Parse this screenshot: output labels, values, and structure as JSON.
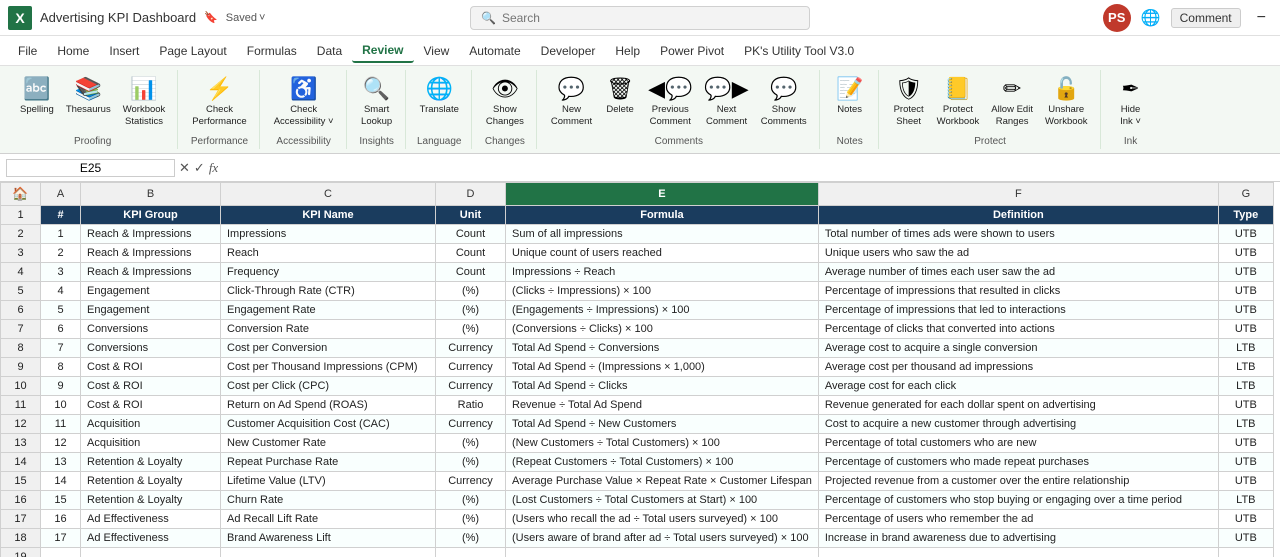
{
  "titleBar": {
    "logo": "X",
    "title": "Advertising KPI Dashboard",
    "saved": "Saved",
    "searchPlaceholder": "Search",
    "commentBtn": "Comment",
    "minimizeBtn": "−",
    "userInitials": "PS"
  },
  "menuBar": {
    "items": [
      "File",
      "Home",
      "Insert",
      "Page Layout",
      "Formulas",
      "Data",
      "Review",
      "View",
      "Automate",
      "Developer",
      "Help",
      "Power Pivot",
      "PK's Utility Tool V3.0"
    ],
    "activeIndex": 6
  },
  "ribbon": {
    "groups": [
      {
        "label": "Proofing",
        "items": [
          {
            "icon": "🔤",
            "label": "Spelling"
          },
          {
            "icon": "📚",
            "label": "Thesaurus"
          },
          {
            "icon": "📊",
            "label": "Workbook\nStatistics"
          }
        ]
      },
      {
        "label": "Performance",
        "items": [
          {
            "icon": "⚡",
            "label": "Check\nPerformance"
          }
        ]
      },
      {
        "label": "Accessibility",
        "items": [
          {
            "icon": "♿",
            "label": "Check\nAccessibility ˅"
          }
        ]
      },
      {
        "label": "Insights",
        "items": [
          {
            "icon": "🔍",
            "label": "Smart\nLookup"
          }
        ]
      },
      {
        "label": "Language",
        "items": [
          {
            "icon": "🌐",
            "label": "Translate"
          }
        ]
      },
      {
        "label": "Changes",
        "items": [
          {
            "icon": "👁",
            "label": "Show\nChanges"
          }
        ]
      },
      {
        "label": "Comments",
        "items": [
          {
            "icon": "💬",
            "label": "New\nComment"
          },
          {
            "icon": "🗑",
            "label": "Delete"
          },
          {
            "icon": "◀💬",
            "label": "Previous\nComment"
          },
          {
            "icon": "💬▶",
            "label": "Next\nComment"
          },
          {
            "icon": "💬",
            "label": "Show\nComments"
          }
        ]
      },
      {
        "label": "Notes",
        "items": [
          {
            "icon": "📝",
            "label": "Notes"
          }
        ]
      },
      {
        "label": "Protect",
        "items": [
          {
            "icon": "🛡",
            "label": "Protect\nSheet"
          },
          {
            "icon": "📒",
            "label": "Protect\nWorkbook"
          },
          {
            "icon": "✏",
            "label": "Allow Edit\nRanges"
          },
          {
            "icon": "🔓",
            "label": "Unshare\nWorkbook"
          }
        ]
      },
      {
        "label": "Ink",
        "items": [
          {
            "icon": "✒",
            "label": "Hide\nInk ˅"
          }
        ]
      }
    ]
  },
  "formulaBar": {
    "cellRef": "E25",
    "formula": ""
  },
  "columns": {
    "headers": [
      "A",
      "B",
      "C",
      "D",
      "E",
      "F",
      "G"
    ],
    "labels": [
      "#",
      "KPI Group",
      "KPI Name",
      "Unit",
      "Formula",
      "Definition",
      "Type"
    ]
  },
  "rows": [
    {
      "num": 1,
      "a": 1,
      "b": "Reach & Impressions",
      "c": "Impressions",
      "d": "Count",
      "e": "Sum of all impressions",
      "f": "Total number of times ads were shown to users",
      "g": "UTB"
    },
    {
      "num": 2,
      "a": 2,
      "b": "Reach & Impressions",
      "c": "Reach",
      "d": "Count",
      "e": "Unique count of users reached",
      "f": "Unique users who saw the ad",
      "g": "UTB"
    },
    {
      "num": 3,
      "a": 3,
      "b": "Reach & Impressions",
      "c": "Frequency",
      "d": "Count",
      "e": "Impressions ÷ Reach",
      "f": "Average number of times each user saw the ad",
      "g": "UTB"
    },
    {
      "num": 4,
      "a": 4,
      "b": "Engagement",
      "c": "Click-Through Rate (CTR)",
      "d": "(%)",
      "e": "(Clicks ÷ Impressions) × 100",
      "f": "Percentage of impressions that resulted in clicks",
      "g": "UTB"
    },
    {
      "num": 5,
      "a": 5,
      "b": "Engagement",
      "c": "Engagement Rate",
      "d": "(%)",
      "e": "(Engagements ÷ Impressions) × 100",
      "f": "Percentage of impressions that led to interactions",
      "g": "UTB"
    },
    {
      "num": 6,
      "a": 6,
      "b": "Conversions",
      "c": "Conversion Rate",
      "d": "(%)",
      "e": "(Conversions ÷ Clicks) × 100",
      "f": "Percentage of clicks that converted into actions",
      "g": "UTB"
    },
    {
      "num": 7,
      "a": 7,
      "b": "Conversions",
      "c": "Cost per Conversion",
      "d": "Currency",
      "e": "Total Ad Spend ÷ Conversions",
      "f": "Average cost to acquire a single conversion",
      "g": "LTB"
    },
    {
      "num": 8,
      "a": 8,
      "b": "Cost & ROI",
      "c": "Cost per Thousand Impressions (CPM)",
      "d": "Currency",
      "e": "Total Ad Spend ÷ (Impressions × 1,000)",
      "f": "Average cost per thousand ad impressions",
      "g": "LTB"
    },
    {
      "num": 9,
      "a": 9,
      "b": "Cost & ROI",
      "c": "Cost per Click (CPC)",
      "d": "Currency",
      "e": "Total Ad Spend ÷ Clicks",
      "f": "Average cost for each click",
      "g": "LTB"
    },
    {
      "num": 10,
      "a": 10,
      "b": "Cost & ROI",
      "c": "Return on Ad Spend (ROAS)",
      "d": "Ratio",
      "e": "Revenue ÷ Total Ad Spend",
      "f": "Revenue generated for each dollar spent on advertising",
      "g": "UTB"
    },
    {
      "num": 11,
      "a": 11,
      "b": "Acquisition",
      "c": "Customer Acquisition Cost (CAC)",
      "d": "Currency",
      "e": "Total Ad Spend ÷ New Customers",
      "f": "Cost to acquire a new customer through advertising",
      "g": "LTB"
    },
    {
      "num": 12,
      "a": 12,
      "b": "Acquisition",
      "c": "New Customer Rate",
      "d": "(%)",
      "e": "(New Customers ÷ Total Customers) × 100",
      "f": "Percentage of total customers who are new",
      "g": "UTB"
    },
    {
      "num": 13,
      "a": 13,
      "b": "Retention & Loyalty",
      "c": "Repeat Purchase Rate",
      "d": "(%)",
      "e": "(Repeat Customers ÷ Total Customers) × 100",
      "f": "Percentage of customers who made repeat purchases",
      "g": "UTB"
    },
    {
      "num": 14,
      "a": 14,
      "b": "Retention & Loyalty",
      "c": "Lifetime Value (LTV)",
      "d": "Currency",
      "e": "Average Purchase Value × Repeat Rate × Customer Lifespan",
      "f": "Projected revenue from a customer over the entire relationship",
      "g": "UTB"
    },
    {
      "num": 15,
      "a": 15,
      "b": "Retention & Loyalty",
      "c": "Churn Rate",
      "d": "(%)",
      "e": "(Lost Customers ÷ Total Customers at Start) × 100",
      "f": "Percentage of customers who stop buying or engaging over a time period",
      "g": "LTB"
    },
    {
      "num": 16,
      "a": 16,
      "b": "Ad Effectiveness",
      "c": "Ad Recall Lift Rate",
      "d": "(%)",
      "e": "(Users who recall the ad ÷ Total users surveyed) × 100",
      "f": "Percentage of users who remember the ad",
      "g": "UTB"
    },
    {
      "num": 17,
      "a": 17,
      "b": "Ad Effectiveness",
      "c": "Brand Awareness Lift",
      "d": "(%)",
      "e": "(Users aware of brand after ad ÷ Total users surveyed) × 100",
      "f": "Increase in brand awareness due to advertising",
      "g": "UTB"
    }
  ]
}
